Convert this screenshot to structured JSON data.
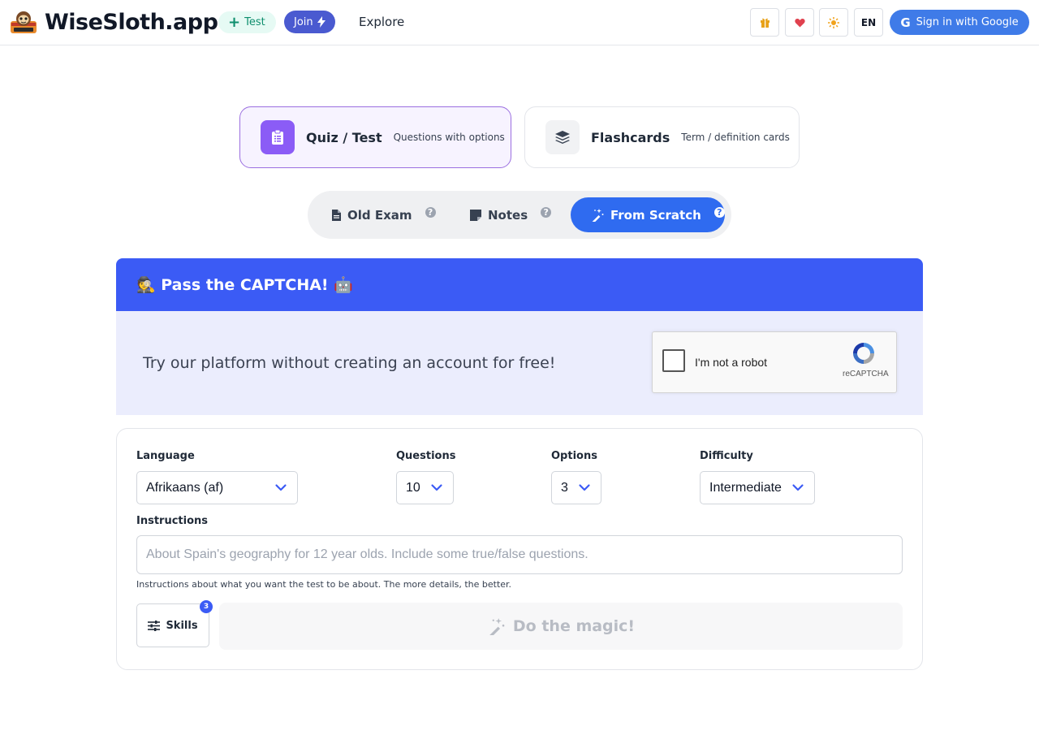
{
  "navbar": {
    "brand": "WiseSloth.app",
    "test_label": "Test",
    "join_label": "Join",
    "explore_label": "Explore",
    "lang_label": "EN",
    "google_label": "Sign in with Google",
    "icons": [
      "gift-icon",
      "heart-icon",
      "sun-icon"
    ]
  },
  "types": [
    {
      "title": "Quiz / Test",
      "subtitle": "Questions with options",
      "selected": true,
      "icon": "clipboard-icon"
    },
    {
      "title": "Flashcards",
      "subtitle": "Term / definition cards",
      "selected": false,
      "icon": "layers-icon"
    }
  ],
  "sources": [
    {
      "label": "Old Exam",
      "icon": "file-icon",
      "active": false
    },
    {
      "label": "Notes",
      "icon": "note-icon",
      "active": false
    },
    {
      "label": "From Scratch",
      "icon": "magic-wand-icon",
      "active": true
    }
  ],
  "captcha": {
    "heading": "🕵️ Pass the CAPTCHA! 🤖",
    "text": "Try our platform without creating an account for free!",
    "checkbox_label": "I'm not a robot",
    "brand": "reCAPTCHA"
  },
  "form": {
    "language": {
      "label": "Language",
      "value": "Afrikaans (af)"
    },
    "questions": {
      "label": "Questions",
      "value": "10"
    },
    "options": {
      "label": "Options",
      "value": "3"
    },
    "difficulty": {
      "label": "Difficulty",
      "value": "Intermediate"
    },
    "instructions": {
      "label": "Instructions",
      "placeholder": "About Spain's geography for 12 year olds. Include some true/false questions.",
      "help": "Instructions about what you want the test to be about. The more details, the better."
    },
    "skills_label": "Skills",
    "skills_count": "3",
    "submit_label": "Do the magic!"
  },
  "colors": {
    "primary": "#3b5bf5",
    "quiz_accent": "#8b5cf6",
    "join": "#4a5ad0",
    "google": "#3f7be8"
  }
}
